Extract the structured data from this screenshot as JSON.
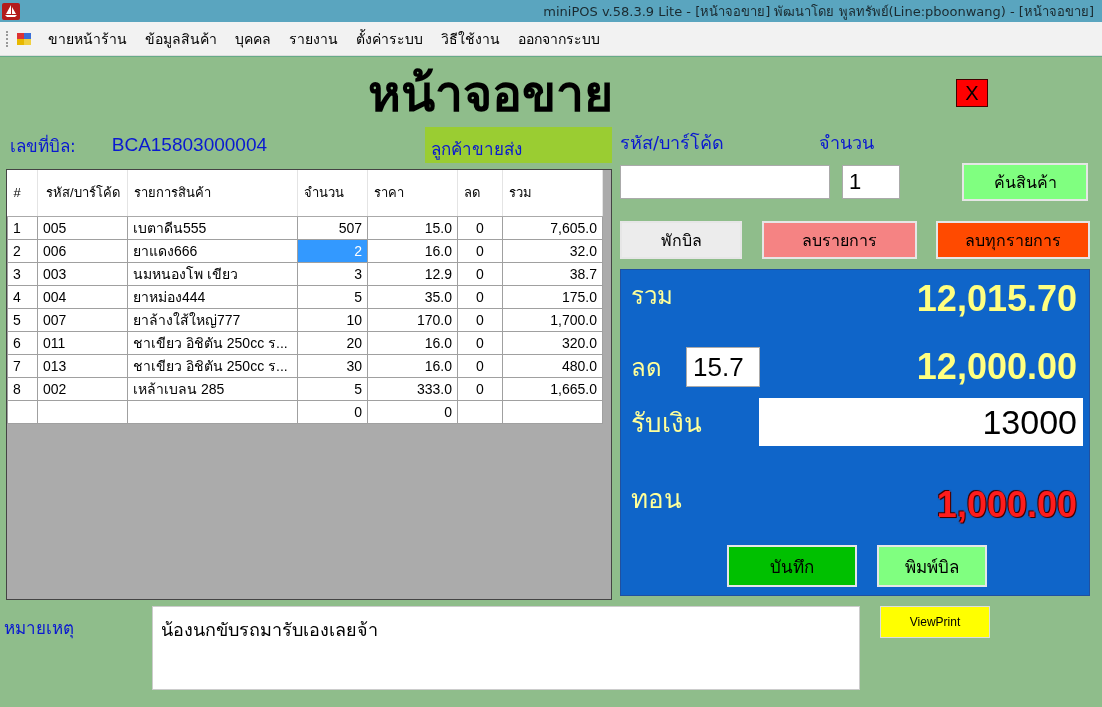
{
  "window": {
    "title": "miniPOS v.58.3.9 Lite  - [หน้าจอขาย] พัฒนาโดย พูลทรัพย์(Line:pboonwang) - [หน้าจอขาย]"
  },
  "menu": [
    "ขายหน้าร้าน",
    "ข้อมูลสินค้า",
    "บุคคล",
    "รายงาน",
    "ตั้งค่าระบบ",
    "วิธีใช้งาน",
    "ออกจากระบบ"
  ],
  "screen_title": "หน้าจอขาย",
  "close_button": "X",
  "bill": {
    "label": "เลขที่บิล:",
    "number": "BCA15803000004",
    "customer_type": "ลูกค้าขายส่ง"
  },
  "table": {
    "columns": [
      "#",
      "รหัส/บาร์โค้ด",
      "รายการสินค้า",
      "จำนวน",
      "ราคา",
      "ลด",
      "รวม"
    ],
    "rows": [
      {
        "no": "1",
        "code": "005",
        "name": "เบตาดีน555",
        "qty": "507",
        "price": "15.0",
        "discount": "0",
        "total": "7,605.0",
        "qty_selected": false
      },
      {
        "no": "2",
        "code": "006",
        "name": "ยาแดง666",
        "qty": "2",
        "price": "16.0",
        "discount": "0",
        "total": "32.0",
        "qty_selected": true
      },
      {
        "no": "3",
        "code": "003",
        "name": "นมหนองโพ เขียว",
        "qty": "3",
        "price": "12.9",
        "discount": "0",
        "total": "38.7",
        "qty_selected": false
      },
      {
        "no": "4",
        "code": "004",
        "name": "ยาหม่อง444",
        "qty": "5",
        "price": "35.0",
        "discount": "0",
        "total": "175.0",
        "qty_selected": false
      },
      {
        "no": "5",
        "code": "007",
        "name": "ยาล้างใส้ใหญ่777",
        "qty": "10",
        "price": "170.0",
        "discount": "0",
        "total": "1,700.0",
        "qty_selected": false
      },
      {
        "no": "6",
        "code": "011",
        "name": "ชาเขียว อิชิตัน 250cc ร...",
        "qty": "20",
        "price": "16.0",
        "discount": "0",
        "total": "320.0",
        "qty_selected": false
      },
      {
        "no": "7",
        "code": "013",
        "name": "ชาเขียว อิชิตัน 250cc ร...",
        "qty": "30",
        "price": "16.0",
        "discount": "0",
        "total": "480.0",
        "qty_selected": false
      },
      {
        "no": "8",
        "code": "002",
        "name": "เหล้าเบลน 285",
        "qty": "5",
        "price": "333.0",
        "discount": "0",
        "total": "1,665.0",
        "qty_selected": false
      },
      {
        "no": "",
        "code": "",
        "name": "",
        "qty": "0",
        "price": "0",
        "discount": "",
        "total": "",
        "qty_selected": false
      }
    ]
  },
  "entry": {
    "code_label": "รหัส/บาร์โค้ด",
    "qty_label": "จำนวน",
    "qty_value": "1",
    "search_button": "ค้นสินค้า"
  },
  "actions": [
    "พักบิล",
    "ลบรายการ",
    "ลบทุกรายการ"
  ],
  "summary": {
    "total_label": "รวม",
    "total": "12,015.70",
    "discount_label": "ลด",
    "discount_value": "15.7",
    "net": "12,000.00",
    "received_label": "รับเงิน",
    "received_value": "13000",
    "change_label": "ทอน",
    "change": "1,000.00",
    "save_button": "บันทึก",
    "print_button": "พิมพ์บิล"
  },
  "remarks": {
    "label": "หมายเหตุ",
    "value": "น้องนกขับรถมารับเองเลยจ้า",
    "view_print_button": "ViewPrint"
  }
}
